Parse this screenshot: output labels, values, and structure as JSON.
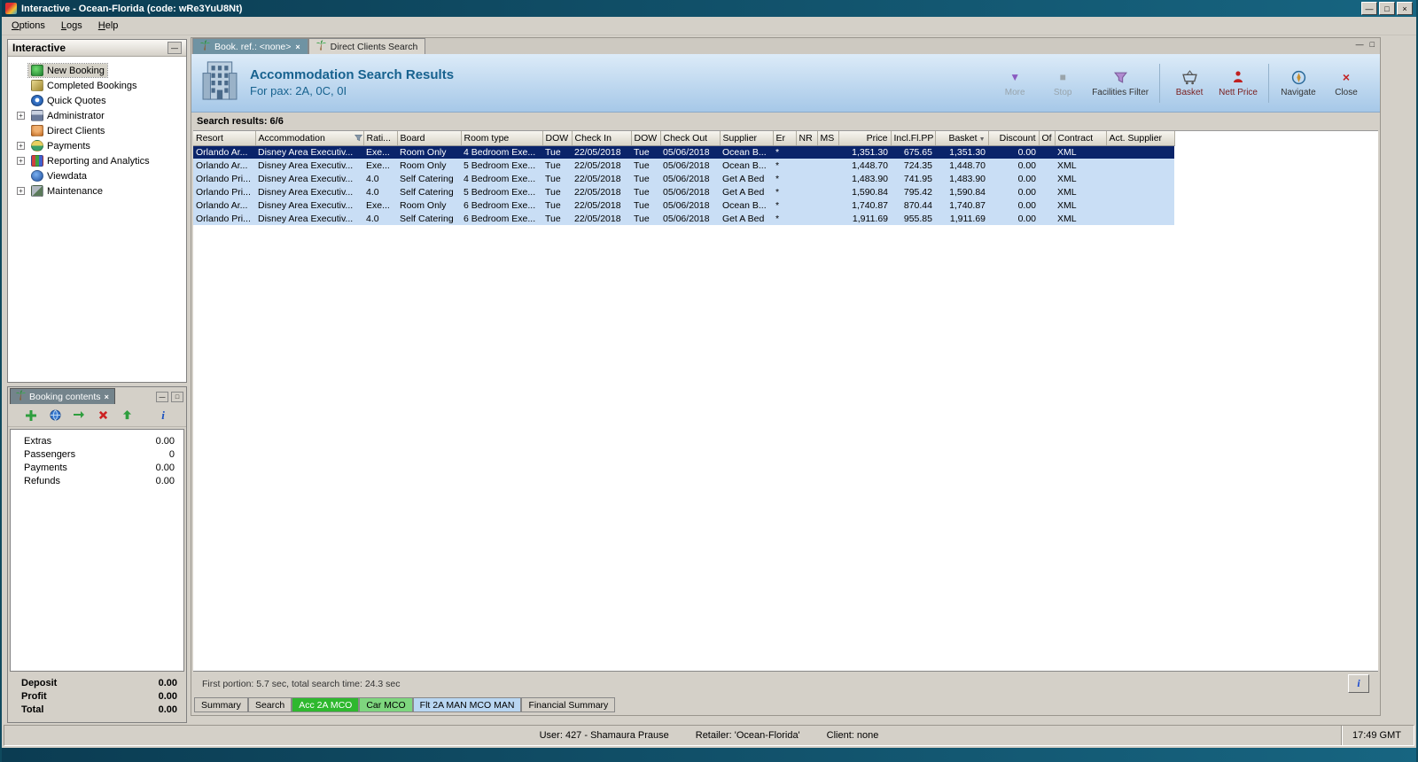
{
  "window": {
    "title": "Interactive - Ocean-Florida (code: wRe3YuU8Nt)"
  },
  "menubar": {
    "items": [
      "Options",
      "Logs",
      "Help"
    ]
  },
  "icons": {
    "minimize": "—",
    "restore": "□",
    "close": "×",
    "tab-close": "×",
    "more-icon": "▼",
    "stop-icon": "■",
    "close-icon": "×",
    "expand": "+",
    "collapse": "—",
    "sort-desc": "▼",
    "info": "i"
  },
  "colors": {
    "selection_row": "#0a246a",
    "result_row": "#c9def5",
    "header_gradient_top": "#dcebf8",
    "header_gradient_bottom": "#a6c8e8",
    "header_title": "#17628f",
    "tab_acc_green": "#2eb82e",
    "tab_car_green": "#7ed67e",
    "tab_flt_blue": "#b9d6f2"
  },
  "sidebar": {
    "title": "Interactive",
    "items": [
      {
        "label": "New Booking",
        "icon": "new-booking-icon",
        "expandable": false,
        "selected": true
      },
      {
        "label": "Completed Bookings",
        "icon": "completed-bookings-icon",
        "expandable": false
      },
      {
        "label": "Quick Quotes",
        "icon": "quick-quotes-icon",
        "expandable": false
      },
      {
        "label": "Administrator",
        "icon": "administrator-icon",
        "expandable": true
      },
      {
        "label": "Direct Clients",
        "icon": "direct-clients-icon",
        "expandable": false
      },
      {
        "label": "Payments",
        "icon": "payments-icon",
        "expandable": true
      },
      {
        "label": "Reporting and Analytics",
        "icon": "reporting-icon",
        "expandable": true
      },
      {
        "label": "Viewdata",
        "icon": "viewdata-icon",
        "expandable": false
      },
      {
        "label": "Maintenance",
        "icon": "maintenance-icon",
        "expandable": true
      }
    ]
  },
  "booking_contents": {
    "title": "Booking contents",
    "items": [
      {
        "label": "Extras",
        "value": "0.00"
      },
      {
        "label": "Passengers",
        "value": "0"
      },
      {
        "label": "Payments",
        "value": "0.00"
      },
      {
        "label": "Refunds",
        "value": "0.00"
      }
    ],
    "totals": [
      {
        "label": "Deposit",
        "value": "0.00"
      },
      {
        "label": "Profit",
        "value": "0.00"
      },
      {
        "label": "Total",
        "value": "0.00"
      }
    ]
  },
  "main": {
    "tabs": [
      {
        "label": "Book. ref.: <none>",
        "active": true,
        "closable": true
      },
      {
        "label": "Direct Clients Search",
        "active": false,
        "closable": false
      }
    ],
    "header": {
      "title": "Accommodation Search Results",
      "subtitle": "For pax: 2A, 0C, 0I",
      "tools": [
        {
          "label": "More",
          "icon": "more-icon",
          "disabled": true
        },
        {
          "label": "Stop",
          "icon": "stop-icon",
          "disabled": true
        },
        {
          "label": "Facilities Filter",
          "icon": "filter-icon",
          "disabled": false
        },
        {
          "label": "Basket",
          "icon": "basket-icon",
          "disabled": false,
          "accent": true
        },
        {
          "label": "Nett Price",
          "icon": "nett-price-icon",
          "disabled": false,
          "accent": true
        },
        {
          "label": "Navigate",
          "icon": "navigate-icon",
          "disabled": false
        },
        {
          "label": "Close",
          "icon": "close-icon",
          "disabled": false
        }
      ]
    },
    "results_label": "Search results: 6/6",
    "table": {
      "columns": [
        "Resort",
        "Accommodation",
        "Rati...",
        "Board",
        "Room type",
        "DOW",
        "Check In",
        "DOW",
        "Check Out",
        "Supplier",
        "Er",
        "NR",
        "MS",
        "Price",
        "Incl.Fl.PP",
        "Basket",
        "Discount",
        "Of",
        "Contract",
        "Act. Supplier"
      ],
      "rows": [
        {
          "selected": true,
          "cells": [
            "Orlando Ar...",
            "Disney Area Executiv...",
            "Exe...",
            "Room Only",
            "4 Bedroom Exe...",
            "Tue",
            "22/05/2018",
            "Tue",
            "05/06/2018",
            "Ocean B...",
            "*",
            "",
            "",
            "1,351.30",
            "675.65",
            "1,351.30",
            "0.00",
            "",
            "XML",
            ""
          ]
        },
        {
          "selected": false,
          "cells": [
            "Orlando Ar...",
            "Disney Area Executiv...",
            "Exe...",
            "Room Only",
            "5 Bedroom Exe...",
            "Tue",
            "22/05/2018",
            "Tue",
            "05/06/2018",
            "Ocean B...",
            "*",
            "",
            "",
            "1,448.70",
            "724.35",
            "1,448.70",
            "0.00",
            "",
            "XML",
            ""
          ]
        },
        {
          "selected": false,
          "cells": [
            "Orlando Pri...",
            "Disney Area Executiv...",
            "4.0",
            "Self Catering",
            "4 Bedroom Exe...",
            "Tue",
            "22/05/2018",
            "Tue",
            "05/06/2018",
            "Get A Bed",
            "*",
            "",
            "",
            "1,483.90",
            "741.95",
            "1,483.90",
            "0.00",
            "",
            "XML",
            ""
          ]
        },
        {
          "selected": false,
          "cells": [
            "Orlando Pri...",
            "Disney Area Executiv...",
            "4.0",
            "Self Catering",
            "5 Bedroom Exe...",
            "Tue",
            "22/05/2018",
            "Tue",
            "05/06/2018",
            "Get A Bed",
            "*",
            "",
            "",
            "1,590.84",
            "795.42",
            "1,590.84",
            "0.00",
            "",
            "XML",
            ""
          ]
        },
        {
          "selected": false,
          "cells": [
            "Orlando Ar...",
            "Disney Area Executiv...",
            "Exe...",
            "Room Only",
            "6 Bedroom Exe...",
            "Tue",
            "22/05/2018",
            "Tue",
            "05/06/2018",
            "Ocean B...",
            "*",
            "",
            "",
            "1,740.87",
            "870.44",
            "1,740.87",
            "0.00",
            "",
            "XML",
            ""
          ]
        },
        {
          "selected": false,
          "cells": [
            "Orlando Pri...",
            "Disney Area Executiv...",
            "4.0",
            "Self Catering",
            "6 Bedroom Exe...",
            "Tue",
            "22/05/2018",
            "Tue",
            "05/06/2018",
            "Get A Bed",
            "*",
            "",
            "",
            "1,911.69",
            "955.85",
            "1,911.69",
            "0.00",
            "",
            "XML",
            ""
          ]
        }
      ]
    },
    "status_text": "First portion: 5.7 sec, total search time: 24.3 sec",
    "bottom_tabs": [
      {
        "label": "Summary",
        "style": "plain"
      },
      {
        "label": "Search",
        "style": "plain"
      },
      {
        "label": "Acc 2A MCO",
        "style": "green"
      },
      {
        "label": "Car MCO",
        "style": "green-light"
      },
      {
        "label": "Flt 2A MAN MCO MAN",
        "style": "blue"
      },
      {
        "label": "Financial Summary",
        "style": "plain"
      }
    ]
  },
  "statusbar": {
    "user": "User: 427 - Shamaura Prause",
    "retailer": "Retailer: 'Ocean-Florida'",
    "client": "Client: none",
    "time": "17:49 GMT"
  }
}
